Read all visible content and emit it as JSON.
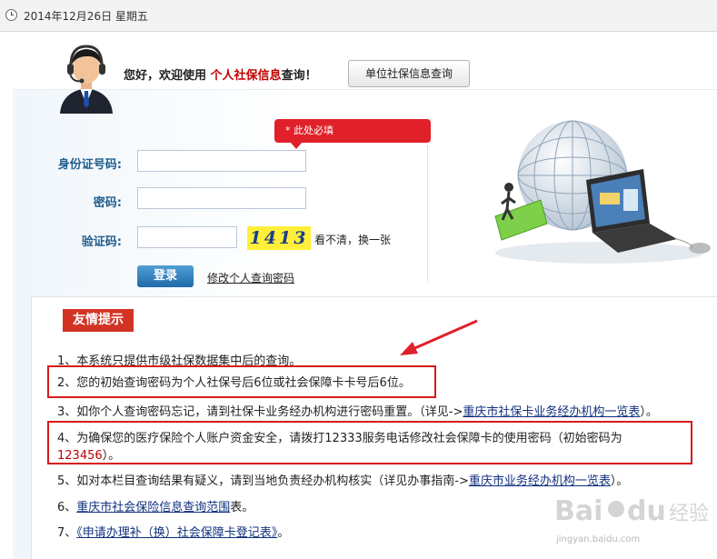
{
  "header": {
    "date": "2014年12月26日 星期五"
  },
  "welcome": {
    "prefix": "您好，欢迎使用",
    "highlight": "个人社保信息",
    "suffix": "查询！"
  },
  "unit_button": "单位社保信息查询",
  "form": {
    "required_tip": "* 此处必填",
    "id_label": "身份证号码:",
    "password_label": "密码:",
    "captcha_label": "验证码:",
    "captcha_text": "1413",
    "refresh_text": "看不清，换一张",
    "login_button": "登录",
    "modify_password_link": "修改个人查询密码"
  },
  "tips": {
    "title": "友情提示",
    "item1": "1、本系统只提供市级社保数据集中后的查询。",
    "item2": "2、您的初始查询密码为个人社保号后6位或社会保障卡卡号后6位。",
    "item3_prefix": "3、如你个人查询密码忘记，请到社保卡业务经办机构进行密码重置。（详见->",
    "item3_link": "重庆市社保卡业务经办机构一览表",
    "item3_suffix": "）。",
    "item4_line1": "4、为确保您的医疗保险个人账户资金安全，请拨打12333服务电话修改社会保障卡的使用密码（初始密码为",
    "item4_code": "123456",
    "item4_end": "）。",
    "item5_prefix": "5、如对本栏目查询结果有疑义，请到当地负责经办机构核实（详见办事指南->",
    "item5_link": "重庆市业务经办机构一览表",
    "item5_suffix": "）。",
    "item6_prefix": "6、",
    "item6_link": "重庆市社会保险信息查询范围",
    "item6_suffix": "表。",
    "item7_prefix": "7、",
    "item7_link": "《申请办理补（换）社会保障卡登记表》",
    "item7_suffix": "。"
  },
  "watermark": {
    "text": "jingyan.baidu.com"
  }
}
